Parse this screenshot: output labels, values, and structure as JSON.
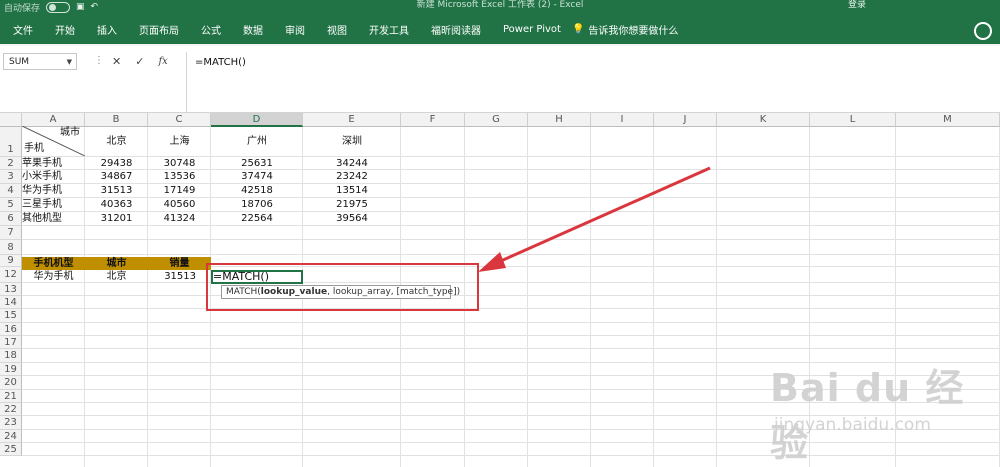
{
  "titlebar": {
    "autosave_label": "自动保存",
    "title": "新建 Microsoft Excel 工作表 (2) - Excel",
    "login": "登录"
  },
  "tabs": [
    "文件",
    "开始",
    "插入",
    "页面布局",
    "公式",
    "数据",
    "审阅",
    "视图",
    "开发工具",
    "福昕阅读器",
    "Power Pivot"
  ],
  "tellme": "告诉我你想要做什么",
  "formula_bar": {
    "name_box": "SUM",
    "cancel": "✕",
    "enter": "✓",
    "fx": "fx",
    "formula": "=MATCH()"
  },
  "columns": [
    "A",
    "B",
    "C",
    "D",
    "E",
    "F",
    "G",
    "H",
    "I",
    "J",
    "K",
    "L",
    "M"
  ],
  "selected_column": "D",
  "rows": [
    "1",
    "2",
    "3",
    "4",
    "5",
    "6",
    "7",
    "8",
    "9",
    "12",
    "13",
    "14",
    "15",
    "16",
    "17",
    "18",
    "19",
    "20",
    "21",
    "22",
    "23",
    "24",
    "25"
  ],
  "table": {
    "corner_top": "城市",
    "corner_bottom": "手机",
    "cities": [
      "北京",
      "上海",
      "广州",
      "深圳"
    ],
    "rows": [
      {
        "name": "苹果手机",
        "values": [
          "29438",
          "30748",
          "25631",
          "34244"
        ]
      },
      {
        "name": "小米手机",
        "values": [
          "34867",
          "13536",
          "37474",
          "23242"
        ]
      },
      {
        "name": "华为手机",
        "values": [
          "31513",
          "17149",
          "42518",
          "13514"
        ]
      },
      {
        "name": "三星手机",
        "values": [
          "40363",
          "40560",
          "18706",
          "21975"
        ]
      },
      {
        "name": "其他机型",
        "values": [
          "31201",
          "41324",
          "22564",
          "39564"
        ]
      }
    ]
  },
  "lookup": {
    "headers": [
      "手机机型",
      "城市",
      "销量"
    ],
    "row": [
      "华为手机",
      "北京",
      "31513"
    ],
    "editing": "=MATCH()"
  },
  "tooltip": {
    "fn": "MATCH(",
    "arg1": "lookup_value",
    "rest": ", lookup_array, [match_type])"
  },
  "watermark": {
    "logo": "Bai du 经验",
    "url": "jingyan.baidu.com"
  },
  "colors": {
    "excel_green": "#217346",
    "header_band": "#bf8f00",
    "annotation_red": "#d9363e"
  }
}
